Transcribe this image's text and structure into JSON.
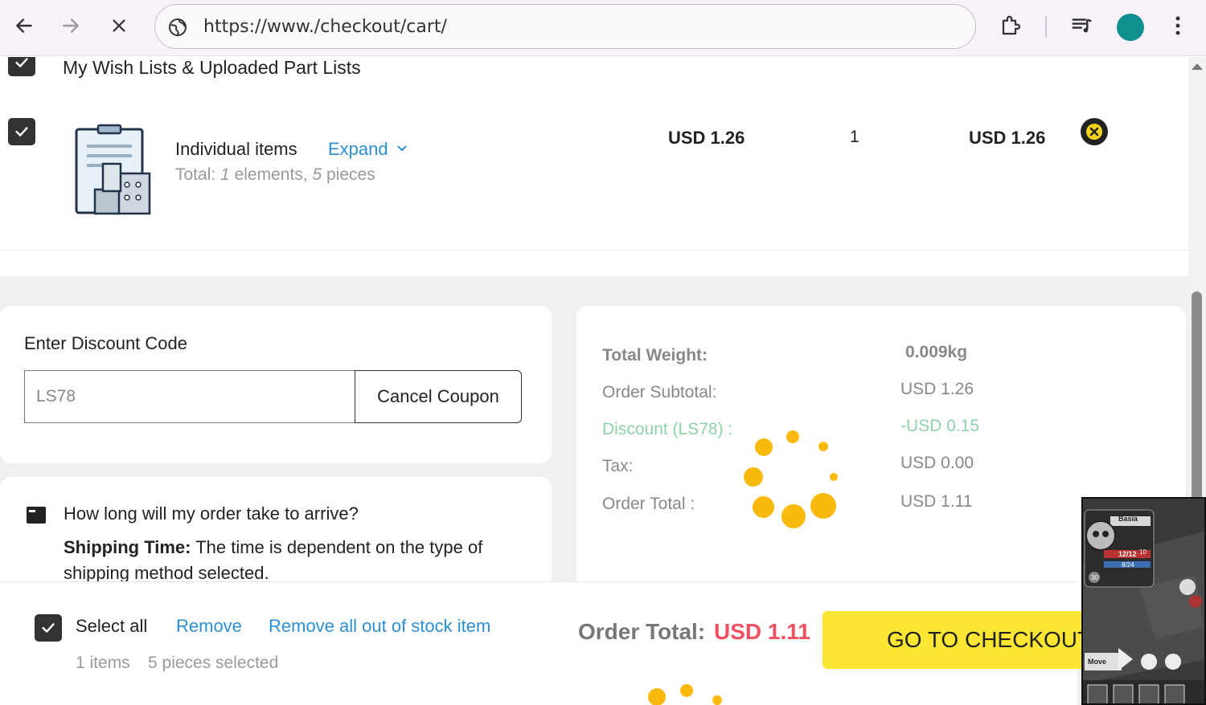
{
  "browser": {
    "url": "https://www./checkout/cart/",
    "back_icon": "arrow-left-icon",
    "forward_icon": "arrow-right-icon",
    "stop_icon": "close-icon",
    "site_info_icon": "globe-icon",
    "extensions_icon": "puzzle-icon",
    "media_icon": "playlist-icon",
    "menu_icon": "kebab-menu-icon",
    "avatar_color": "#0f8f8f"
  },
  "cart": {
    "wish_list_title": "My Wish Lists & Uploaded Part Lists",
    "item": {
      "name": "Individual items",
      "expand_label": "Expand",
      "total_prefix": "Total:",
      "elements_count": "1",
      "elements_label": "elements,",
      "pieces_count": "5",
      "pieces_label": "pieces",
      "unit_price": "USD 1.26",
      "quantity": "1",
      "line_total": "USD 1.26"
    }
  },
  "discount": {
    "label": "Enter Discount Code",
    "code": "LS78",
    "cancel_label": "Cancel Coupon"
  },
  "shipping": {
    "question": "How long will my order take to arrive?",
    "title": "Shipping Time:",
    "text": "The time is dependent on the type of shipping method selected."
  },
  "summary": {
    "weight_label": "Total Weight:",
    "weight_value": "0.009kg",
    "subtotal_label": "Order Subtotal:",
    "subtotal_value": "USD 1.26",
    "discount_label": "Discount (LS78) :",
    "discount_value": "-USD 0.15",
    "tax_label": "Tax:",
    "tax_value": "USD 0.00",
    "total_label": "Order Total :",
    "total_value": "USD 1.11"
  },
  "footer": {
    "select_all": "Select all",
    "remove": "Remove",
    "remove_oos": "Remove all out of stock item",
    "items_count": "1 items",
    "pieces_selected": "5 pieces selected",
    "order_total_label": "Order Total:",
    "order_total_value": "USD 1.11",
    "checkout_label": "GO TO CHECKOUT"
  },
  "overlay": {
    "name": "Basia",
    "hp": "12/12",
    "hp_side": "10",
    "xp": "8/24",
    "coins": "30",
    "move_label": "Move"
  },
  "colors": {
    "link": "#2b8fd6",
    "discount_green": "#8fd1a8",
    "total_red": "#f0505f",
    "checkout_yellow": "#fbe634",
    "spinner": "#f9b90d"
  }
}
